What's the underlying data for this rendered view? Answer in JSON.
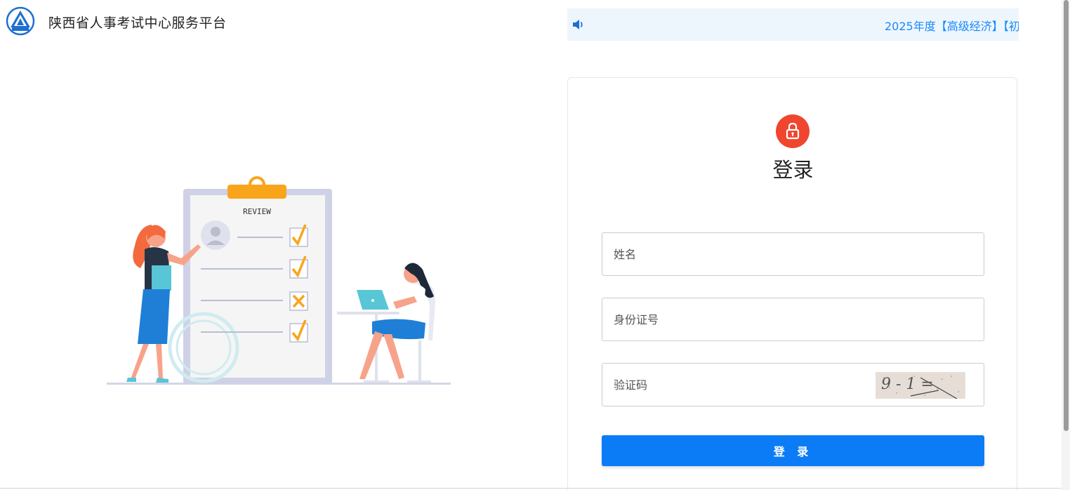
{
  "header": {
    "site_title": "陕西省人事考试中心服务平台",
    "logo_icon": "sxpta-logo"
  },
  "notice": {
    "icon": "speaker-icon",
    "text": "2025年度【高级经济】【初"
  },
  "illustration": {
    "clipboard_label": "REVIEW"
  },
  "login": {
    "icon": "lock-icon",
    "title": "登录",
    "name_placeholder": "姓名",
    "id_placeholder": "身份证号",
    "captcha_placeholder": "验证码",
    "captcha_text": "9 - 1 =",
    "submit_label": "登 录"
  },
  "colors": {
    "accent": "#0b7cf6",
    "lock_bg": "#f0452f",
    "notice_bg": "#eef6fd",
    "notice_text": "#1989fa"
  }
}
